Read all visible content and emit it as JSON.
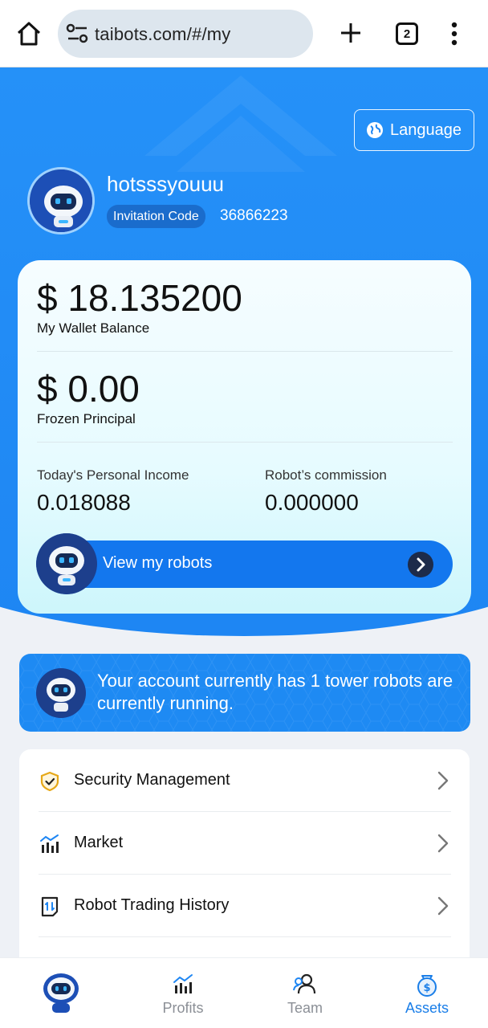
{
  "browser": {
    "url": "taibots.com/#/my",
    "tab_count": "2"
  },
  "header": {
    "language_label": "Language",
    "username": "hotsssyouuu",
    "invitation_label": "Invitation Code",
    "invitation_code": "36866223"
  },
  "wallet": {
    "balance": "$ 18.135200",
    "balance_label": "My Wallet Balance",
    "frozen": "$ 0.00",
    "frozen_label": "Frozen Principal",
    "income_label": "Today's Personal Income",
    "income_value": "0.018088",
    "commission_label": "Robot’s commission",
    "commission_value": "0.000000",
    "view_robots_label": "View my robots"
  },
  "notice": {
    "text": "Your account currently has 1 tower robots are currently running."
  },
  "menu": {
    "items": [
      {
        "label": "Security Management",
        "icon": "shield-check-icon"
      },
      {
        "label": "Market",
        "icon": "chart-bars-icon"
      },
      {
        "label": "Robot Trading History",
        "icon": "history-doc-icon"
      }
    ]
  },
  "nav": {
    "items": [
      {
        "label": "",
        "icon": "robot-avatar-icon"
      },
      {
        "label": "Profits",
        "icon": "chart-icon"
      },
      {
        "label": "Team",
        "icon": "team-icon"
      },
      {
        "label": "Assets",
        "icon": "wallet-bag-icon",
        "active": true
      }
    ]
  },
  "colors": {
    "primary": "#1e86f3",
    "nav_active": "#1a7ee8",
    "nav_inactive": "#8b8f96"
  }
}
